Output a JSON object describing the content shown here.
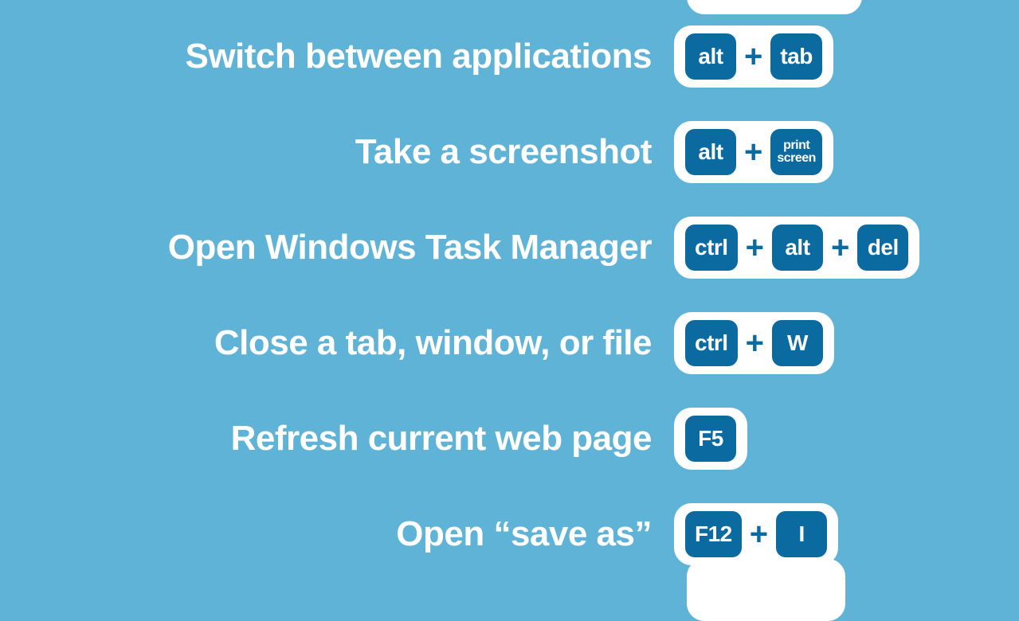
{
  "shortcuts": [
    {
      "label": "Switch between applications",
      "keys": [
        "alt",
        "tab"
      ]
    },
    {
      "label": "Take a screenshot",
      "keys": [
        "alt",
        "print\nscreen"
      ]
    },
    {
      "label": "Open Windows Task Manager",
      "keys": [
        "ctrl",
        "alt",
        "del"
      ]
    },
    {
      "label": "Close a tab, window, or file",
      "keys": [
        "ctrl",
        "W"
      ]
    },
    {
      "label": "Refresh current web page",
      "keys": [
        "F5"
      ]
    },
    {
      "label": "Open “save as”",
      "keys": [
        "F12",
        "I"
      ]
    }
  ],
  "plus_symbol": "+",
  "colors": {
    "background": "#5eb3d6",
    "key_fill": "#0b6a9f",
    "key_group_bg": "#ffffff",
    "label_text": "#ffffff"
  }
}
